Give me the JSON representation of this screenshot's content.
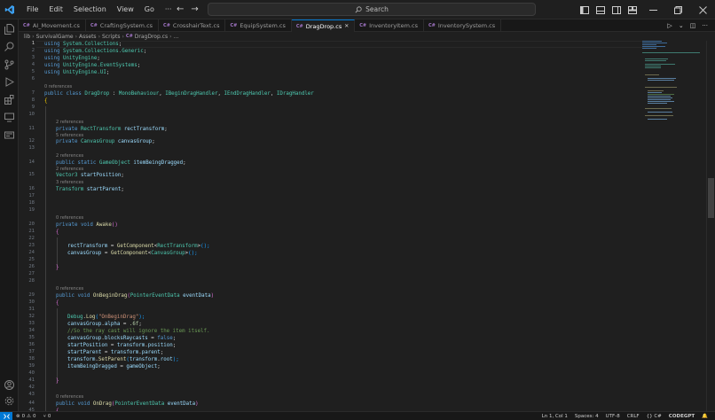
{
  "menu": [
    "File",
    "Edit",
    "Selection",
    "View",
    "Go",
    "···"
  ],
  "search": {
    "label": "Search"
  },
  "tabs": [
    {
      "label": "AI_Movement.cs",
      "active": false
    },
    {
      "label": "CraftingSystem.cs",
      "active": false
    },
    {
      "label": "CrosshairText.cs",
      "active": false
    },
    {
      "label": "EquipSystem.cs",
      "active": false
    },
    {
      "label": "DragDrop.cs",
      "active": true
    },
    {
      "label": "InventoryItem.cs",
      "active": false
    },
    {
      "label": "InventorySystem.cs",
      "active": false
    }
  ],
  "breadcrumb": [
    "lib",
    "SurvivalGame",
    "Assets",
    "Scripts",
    "DragDrop.cs"
  ],
  "codelens": {
    "zero_refs": "0 references",
    "two_refs": "2 references",
    "five_refs": "5 references",
    "three_refs": "3 references"
  },
  "code": {
    "l1": [
      "using",
      "System.Collections",
      ";"
    ],
    "l2": [
      "using",
      "System.Collections.Generic",
      ";"
    ],
    "l3": [
      "using",
      "UnityEngine",
      ";"
    ],
    "l4": [
      "using",
      "UnityEngine.EventSystems",
      ";"
    ],
    "l5": [
      "using",
      "UnityEngine.UI",
      ";"
    ],
    "l7": [
      "public",
      "class",
      "DragDrop",
      ":",
      "MonoBehaviour",
      ",",
      "IBeginDragHandler",
      ",",
      "IEndDragHandler",
      ",",
      "IDragHandler"
    ],
    "l8": "{",
    "l11": [
      "private",
      "RectTransform",
      "rectTransform",
      ";"
    ],
    "l12": [
      "private",
      "CanvasGroup",
      "canvasGroup",
      ";"
    ],
    "l14": [
      "public",
      "static",
      "GameObject",
      "itemBeingDragged",
      ";"
    ],
    "l15": [
      "Vector3",
      "startPosition",
      ";"
    ],
    "l16": [
      "Transform",
      "startParent",
      ";"
    ],
    "l20": [
      "private",
      "void",
      "Awake",
      "()"
    ],
    "l21": "{",
    "l23": [
      "rectTransform",
      " = ",
      "GetComponent",
      "<",
      "RectTransform",
      ">",
      "();"
    ],
    "l24": [
      "canvasGroup",
      " = ",
      "GetComponent",
      "<",
      "CanvasGroup",
      ">",
      "();"
    ],
    "l26": "}",
    "l29": [
      "public",
      "void",
      "OnBeginDrag",
      "(",
      "PointerEventData",
      "eventData",
      ")"
    ],
    "l30": "{",
    "l32": [
      "Debug",
      ".",
      "Log",
      "(",
      "\"OnBeginDrag\"",
      ");"
    ],
    "l33": [
      "canvasGroup",
      ".",
      "alpha",
      " = ",
      ".6f",
      ";"
    ],
    "l34": "//So the ray cast will ignore the item itself.",
    "l35": [
      "canvasGroup",
      ".",
      "blocksRaycasts",
      " = ",
      "false",
      ";"
    ],
    "l36": [
      "startPosition",
      " = ",
      "transform",
      ".",
      "position",
      ";"
    ],
    "l37": [
      "startParent",
      " = ",
      "transform",
      ".",
      "parent",
      ";"
    ],
    "l38": [
      "transform",
      ".",
      "SetParent",
      "(",
      "transform",
      ".",
      "root",
      ");"
    ],
    "l39": [
      "itemBeingDragged",
      " = ",
      "gameObject",
      ";"
    ],
    "l41": "}",
    "l44": [
      "public",
      "void",
      "OnDrag",
      "(",
      "PointerEventData",
      "eventData",
      ")"
    ],
    "l45": "{"
  },
  "line_numbers": [
    "1",
    "2",
    "3",
    "4",
    "5",
    "6",
    "7",
    "8",
    "9",
    "10",
    "11",
    "12",
    "13",
    "14",
    "15",
    "16",
    "17",
    "18",
    "19",
    "20",
    "21",
    "22",
    "23",
    "24",
    "25",
    "26",
    "27",
    "28",
    "29",
    "30",
    "31",
    "32",
    "33",
    "34",
    "35",
    "36",
    "37",
    "38",
    "39",
    "40",
    "41",
    "42",
    "43",
    "44",
    "45"
  ],
  "status": {
    "errors": "0",
    "warnings": "0",
    "ports": "0",
    "position": "Ln 1, Col 1",
    "spaces": "Spaces: 4",
    "encoding": "UTF-8",
    "eol": "CRLF",
    "language": "{} C#",
    "extension": "CODEGPT"
  },
  "colors": {
    "accent": "#0078d4",
    "keyword": "#569cd6",
    "type": "#4ec9b0",
    "function": "#dcdcaa",
    "variable": "#9cdcfe",
    "string": "#ce9178",
    "comment": "#6a9955"
  }
}
